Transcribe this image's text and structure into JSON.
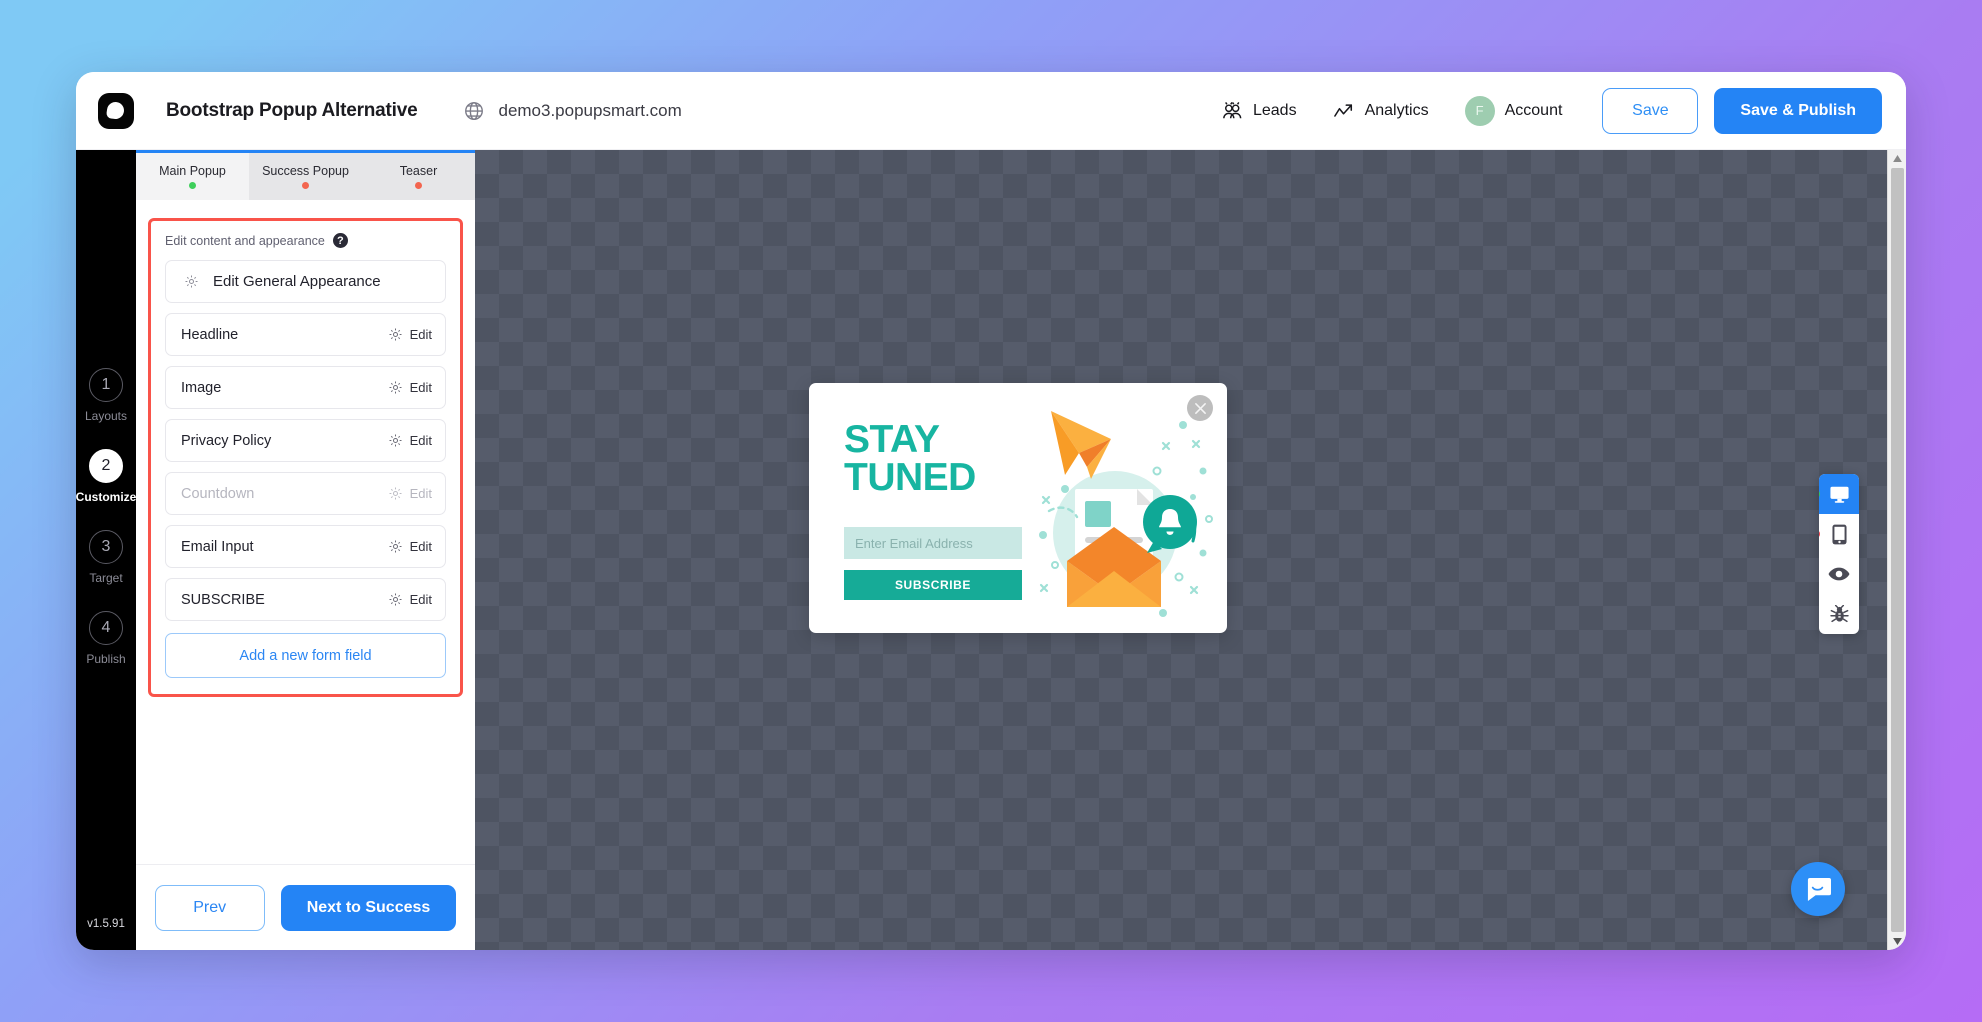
{
  "header": {
    "logo_icon": "popupsmart-logo-icon",
    "project_title": "Bootstrap Popup Alternative",
    "globe_icon": "globe-icon",
    "domain": "demo3.popupsmart.com",
    "leads_icon": "leads-icon",
    "leads_label": "Leads",
    "analytics_icon": "analytics-icon",
    "analytics_label": "Analytics",
    "avatar_initial": "F",
    "account_label": "Account",
    "save_label": "Save",
    "save_publish_label": "Save & Publish"
  },
  "steps": [
    {
      "number": "1",
      "label": "Layouts",
      "active": false
    },
    {
      "number": "2",
      "label": "Customize",
      "active": true
    },
    {
      "number": "3",
      "label": "Target",
      "active": false
    },
    {
      "number": "4",
      "label": "Publish",
      "active": false
    }
  ],
  "version": "v1.5.91",
  "tabs": [
    {
      "label": "Main Popup",
      "status": "green",
      "active": true
    },
    {
      "label": "Success Popup",
      "status": "red",
      "active": false
    },
    {
      "label": "Teaser",
      "status": "red",
      "active": false
    }
  ],
  "editor": {
    "section_title": "Edit content and appearance",
    "help_glyph": "?",
    "general_button": "Edit General Appearance",
    "edit_label": "Edit",
    "fields": [
      {
        "name": "Headline",
        "disabled": false
      },
      {
        "name": "Image",
        "disabled": false
      },
      {
        "name": "Privacy Policy",
        "disabled": false
      },
      {
        "name": "Countdown",
        "disabled": true
      },
      {
        "name": "Email Input",
        "disabled": false
      },
      {
        "name": "SUBSCRIBE",
        "disabled": false
      }
    ],
    "add_field_label": "Add a new form field",
    "prev_label": "Prev",
    "next_label": "Next to Success",
    "highlight_color": "#f9544a"
  },
  "popup": {
    "close_icon": "close-icon",
    "headline_line1": "STAY",
    "headline_line2": "TUNED",
    "email_placeholder": "Enter Email Address",
    "subscribe_label": "SUBSCRIBE",
    "accent_color": "#16ab97",
    "illustration": "email-newsletter-illustration"
  },
  "device_bar": [
    {
      "icon": "desktop-icon",
      "active": true,
      "dot": "green"
    },
    {
      "icon": "mobile-icon",
      "active": false,
      "dot": "red"
    },
    {
      "icon": "eye-preview-icon",
      "active": false,
      "dot": "none"
    },
    {
      "icon": "bug-debug-icon",
      "active": false,
      "dot": "none"
    }
  ],
  "chat": {
    "icon": "chat-bubble-icon"
  },
  "scrollbar": {
    "up_glyph": "▲",
    "down_glyph": "▼"
  }
}
